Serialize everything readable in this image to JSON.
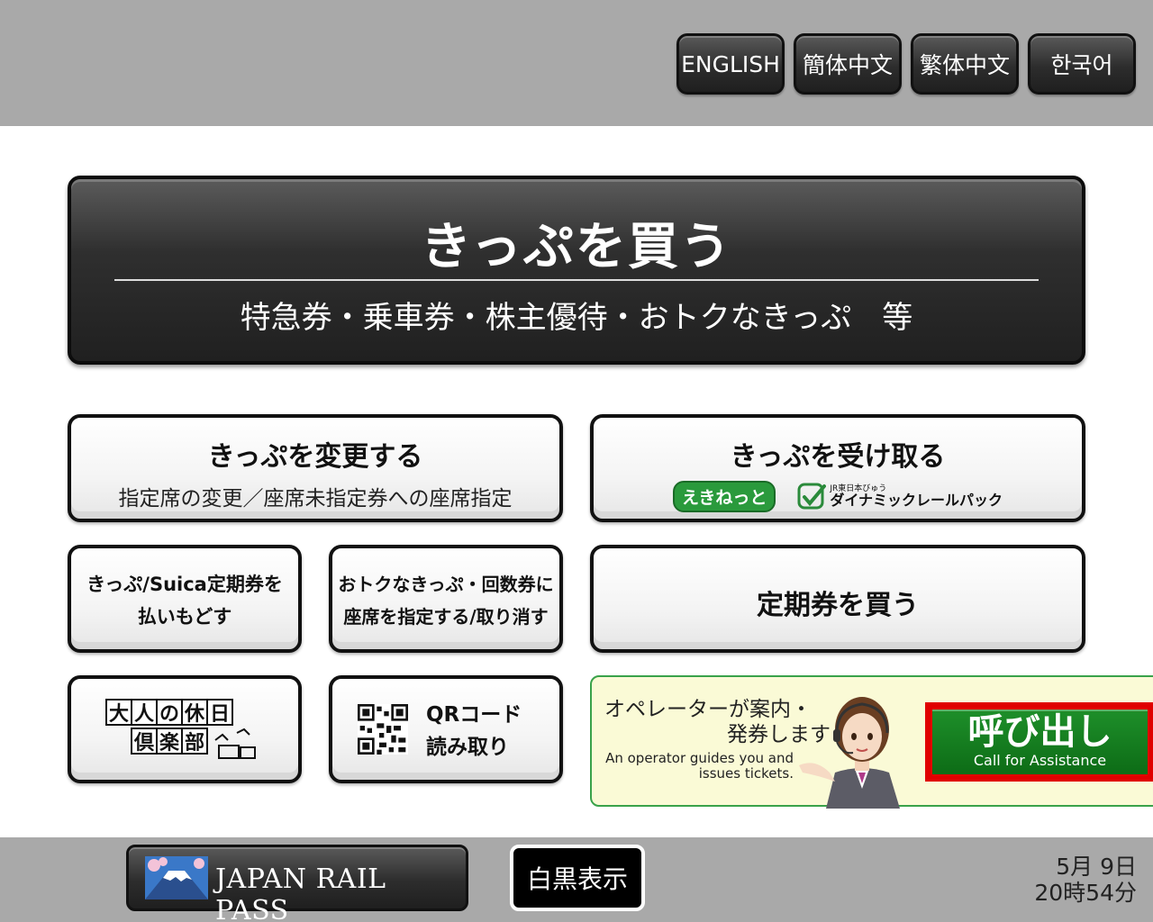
{
  "languages": [
    {
      "label": "ENGLISH"
    },
    {
      "label": "簡体中文"
    },
    {
      "label": "繁体中文"
    },
    {
      "label": "한국어"
    }
  ],
  "main": {
    "title": "きっぷを買う",
    "subtitle": "特急券・乗車券・株主優待・おトクなきっぷ　等"
  },
  "change": {
    "title": "きっぷを変更する",
    "subtitle": "指定席の変更／座席未指定券への座席指定"
  },
  "receive": {
    "title": "きっぷを受け取る",
    "ekinet": "えきねっと",
    "dynamic_small": "JR東日本びゅう",
    "dynamic_big": "ダイナミックレールパック"
  },
  "refund": {
    "line1": "きっぷ/Suica定期券を",
    "line2": "払いもどす"
  },
  "reserve": {
    "line1": "おトクなきっぷ・回数券に",
    "line2": "座席を指定する/取り消す"
  },
  "commuter": {
    "title": "定期券を買う"
  },
  "club": {
    "row1": [
      "大",
      "人",
      "の",
      "休",
      "日"
    ],
    "row2": [
      "倶",
      "楽",
      "部"
    ]
  },
  "qr": {
    "line1": "QRコード",
    "line2": "読み取り"
  },
  "assist": {
    "jp_line1": "オペレーターが案内・",
    "jp_line2": "発券します",
    "en_line1": "An operator guides you and",
    "en_line2": "issues tickets.",
    "call_jp": "呼び出し",
    "call_en": "Call for Assistance",
    "accent": "#e00000",
    "green": "#1e8f2a"
  },
  "footer": {
    "jrp_label": "JAPAN RAIL PASS",
    "bw_label": "白黒表示",
    "date": "5月  9日",
    "time": "20時54分"
  }
}
